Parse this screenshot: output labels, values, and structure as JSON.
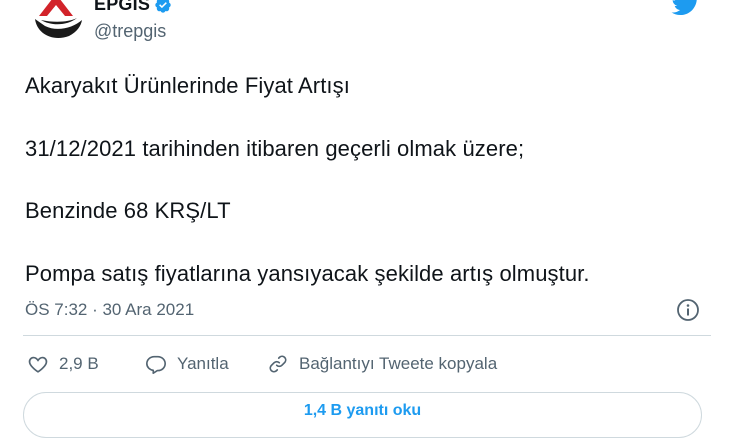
{
  "account": {
    "display_name": "EPGIS",
    "handle": "@trepgis",
    "verified": true,
    "avatar_icon": "epgis-logo-icon",
    "brand_icon": "twitter-bird-icon"
  },
  "tweet": {
    "lines": [
      "Akaryakıt Ürünlerinde Fiyat Artışı",
      "31/12/2021 tarihinden itibaren geçerli olmak üzere;",
      "Benzinde 68 KRŞ/LT",
      "Pompa satış fiyatlarına yansıyacak şekilde artış olmuştur."
    ],
    "timestamp": "ÖS 7:32 · 30 Ara 2021"
  },
  "actions": {
    "like_count": "2,9 B",
    "reply_label": "Yanıtla",
    "copy_link_label": "Bağlantıyı Tweete kopyala"
  },
  "read_replies_label": "1,4 B yanıtı oku",
  "colors": {
    "text": "#0f1419",
    "secondary": "#536471",
    "accent": "#1d9bf0",
    "divider": "#cfd9de"
  }
}
